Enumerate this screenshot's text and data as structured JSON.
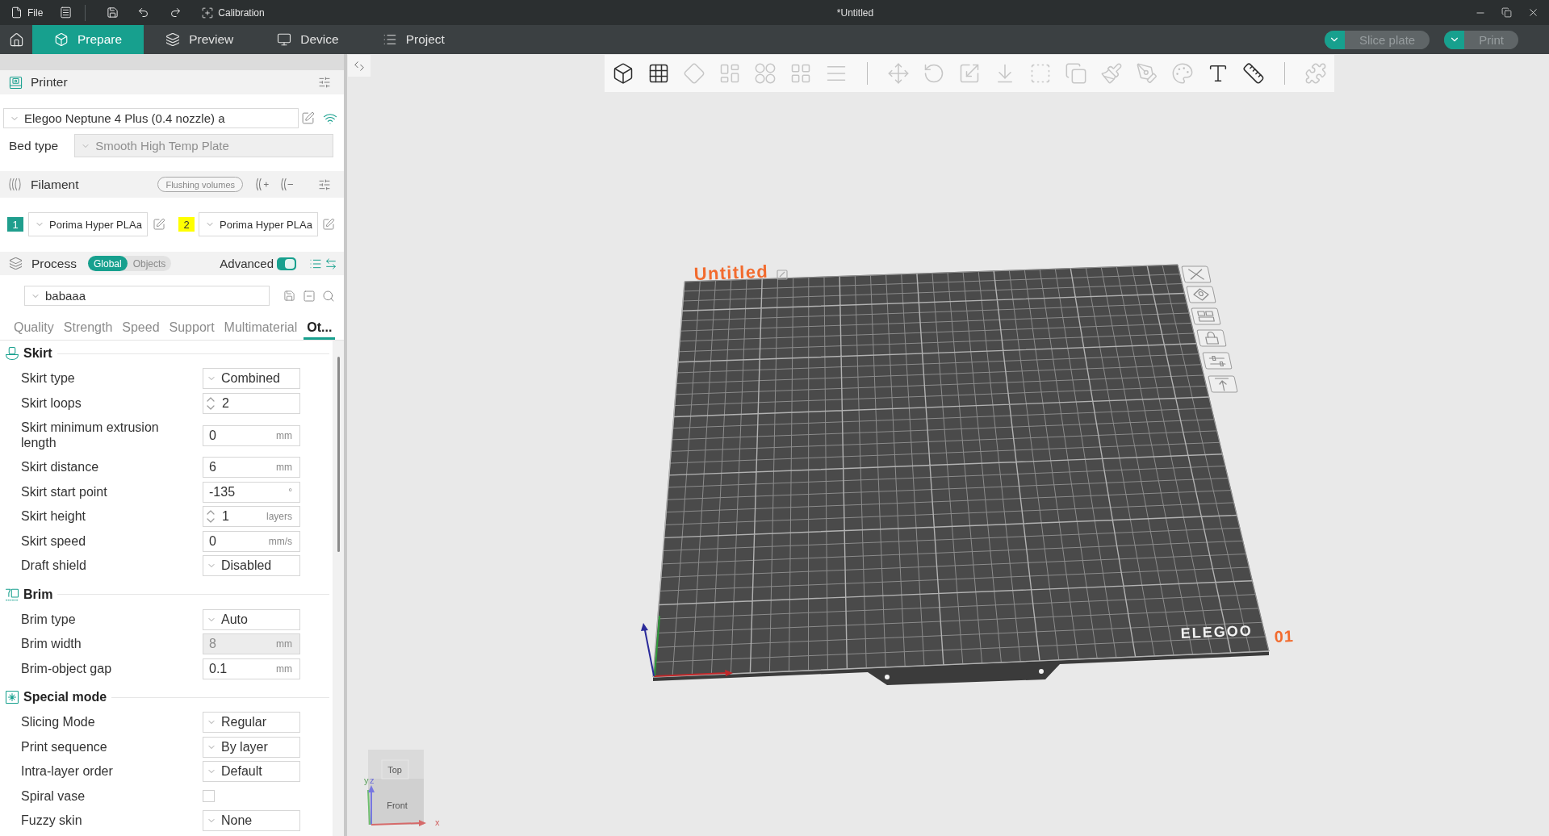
{
  "title_bar": {
    "file": "File",
    "calibration": "Calibration",
    "title": "*Untitled"
  },
  "tabs": [
    {
      "kind": "prepare",
      "label": "Prepare",
      "selected": true
    },
    {
      "kind": "preview",
      "label": "Preview",
      "selected": false
    },
    {
      "kind": "device",
      "label": "Device",
      "selected": false
    },
    {
      "kind": "project",
      "label": "Project",
      "selected": false
    }
  ],
  "actions": [
    {
      "label": "Slice plate",
      "disabled": true
    },
    {
      "label": "Print",
      "disabled": true
    }
  ],
  "printer": {
    "title": "Printer",
    "preset": "Elegoo Neptune 4 Plus (0.4 nozzle) a",
    "bed_type": {
      "label": "Bed type",
      "value": "Smooth High Temp Plate",
      "disabled": true
    }
  },
  "filament": {
    "title": "Filament",
    "flushing": "Flushing volumes",
    "slots": [
      {
        "number": "1",
        "color": "#1f9e8d",
        "preset": "Porima Hyper PLAa"
      },
      {
        "number": "2",
        "color": "#ffff00",
        "preset": "Porima Hyper PLAa"
      }
    ]
  },
  "process": {
    "title": "Process",
    "scope": [
      {
        "label": "Global",
        "selected": true
      },
      {
        "label": "Objects",
        "selected": false
      }
    ],
    "advanced": {
      "label": "Advanced",
      "on": true
    },
    "preset": "babaaa",
    "tabs": [
      {
        "label": "Quality",
        "selected": false
      },
      {
        "label": "Strength",
        "selected": false
      },
      {
        "label": "Speed",
        "selected": false
      },
      {
        "label": "Support",
        "selected": false
      },
      {
        "label": "Multimaterial",
        "selected": false
      },
      {
        "label": "Ot...",
        "selected": true
      }
    ]
  },
  "sections": [
    {
      "kind": "skirt",
      "title": "Skirt",
      "options": [
        {
          "label": "Skirt type",
          "kind": "select",
          "value": "Combined",
          "disabled": false
        },
        {
          "label": "Skirt loops",
          "kind": "spin",
          "value": "2",
          "disabled": false
        },
        {
          "label": "Skirt minimum extrusion length",
          "kind": "number",
          "value": "0",
          "unit": "mm",
          "disabled": false
        },
        {
          "label": "Skirt distance",
          "kind": "number",
          "value": "6",
          "unit": "mm",
          "disabled": false
        },
        {
          "label": "Skirt start point",
          "kind": "number",
          "value": "-135",
          "unit": "°",
          "disabled": false
        },
        {
          "label": "Skirt height",
          "kind": "spin",
          "value": "1",
          "unit": "layers",
          "disabled": false
        },
        {
          "label": "Skirt speed",
          "kind": "number",
          "value": "0",
          "unit": "mm/s",
          "disabled": false
        },
        {
          "label": "Draft shield",
          "kind": "select",
          "value": "Disabled",
          "disabled": false
        }
      ]
    },
    {
      "kind": "brim",
      "title": "Brim",
      "options": [
        {
          "label": "Brim type",
          "kind": "select",
          "value": "Auto",
          "disabled": false
        },
        {
          "label": "Brim width",
          "kind": "number",
          "value": "8",
          "unit": "mm",
          "disabled": true
        },
        {
          "label": "Brim-object gap",
          "kind": "number",
          "value": "0.1",
          "unit": "mm",
          "disabled": false
        }
      ]
    },
    {
      "kind": "special",
      "title": "Special mode",
      "options": [
        {
          "label": "Slicing Mode",
          "kind": "select",
          "value": "Regular",
          "disabled": false
        },
        {
          "label": "Print sequence",
          "kind": "select",
          "value": "By layer",
          "disabled": false
        },
        {
          "label": "Intra-layer order",
          "kind": "select",
          "value": "Default",
          "disabled": false
        },
        {
          "label": "Spiral vase",
          "kind": "checkbox",
          "checked": false,
          "disabled": false
        },
        {
          "label": "Fuzzy skin",
          "kind": "select",
          "value": "None",
          "disabled": false
        }
      ]
    }
  ],
  "toolbar": {
    "groups": [
      [
        {
          "kind": "add-cube",
          "disabled": false
        },
        {
          "kind": "add-plate",
          "disabled": false
        },
        {
          "kind": "orient",
          "disabled": true
        },
        {
          "kind": "arrange",
          "disabled": true
        },
        {
          "kind": "split-objects",
          "disabled": true
        },
        {
          "kind": "split-parts",
          "disabled": true
        },
        {
          "kind": "layers",
          "disabled": true
        }
      ],
      [
        {
          "kind": "move",
          "disabled": true
        },
        {
          "kind": "rotate",
          "disabled": true
        },
        {
          "kind": "scale",
          "disabled": true
        },
        {
          "kind": "lay-on-face",
          "disabled": true
        },
        {
          "kind": "cut",
          "disabled": true
        },
        {
          "kind": "boolean",
          "disabled": true
        },
        {
          "kind": "support-paint",
          "disabled": true
        },
        {
          "kind": "seam-paint",
          "disabled": true
        },
        {
          "kind": "color-paint",
          "disabled": true
        },
        {
          "kind": "text",
          "disabled": false
        },
        {
          "kind": "measure",
          "disabled": false
        }
      ],
      [
        {
          "kind": "assembly",
          "disabled": true
        }
      ]
    ]
  },
  "plate": {
    "name": "Untitled",
    "number": "01",
    "logo": "ELEGOO"
  },
  "view_cube": {
    "top": "Top",
    "front": "Front",
    "x": "x",
    "y": "y",
    "z": "z"
  }
}
